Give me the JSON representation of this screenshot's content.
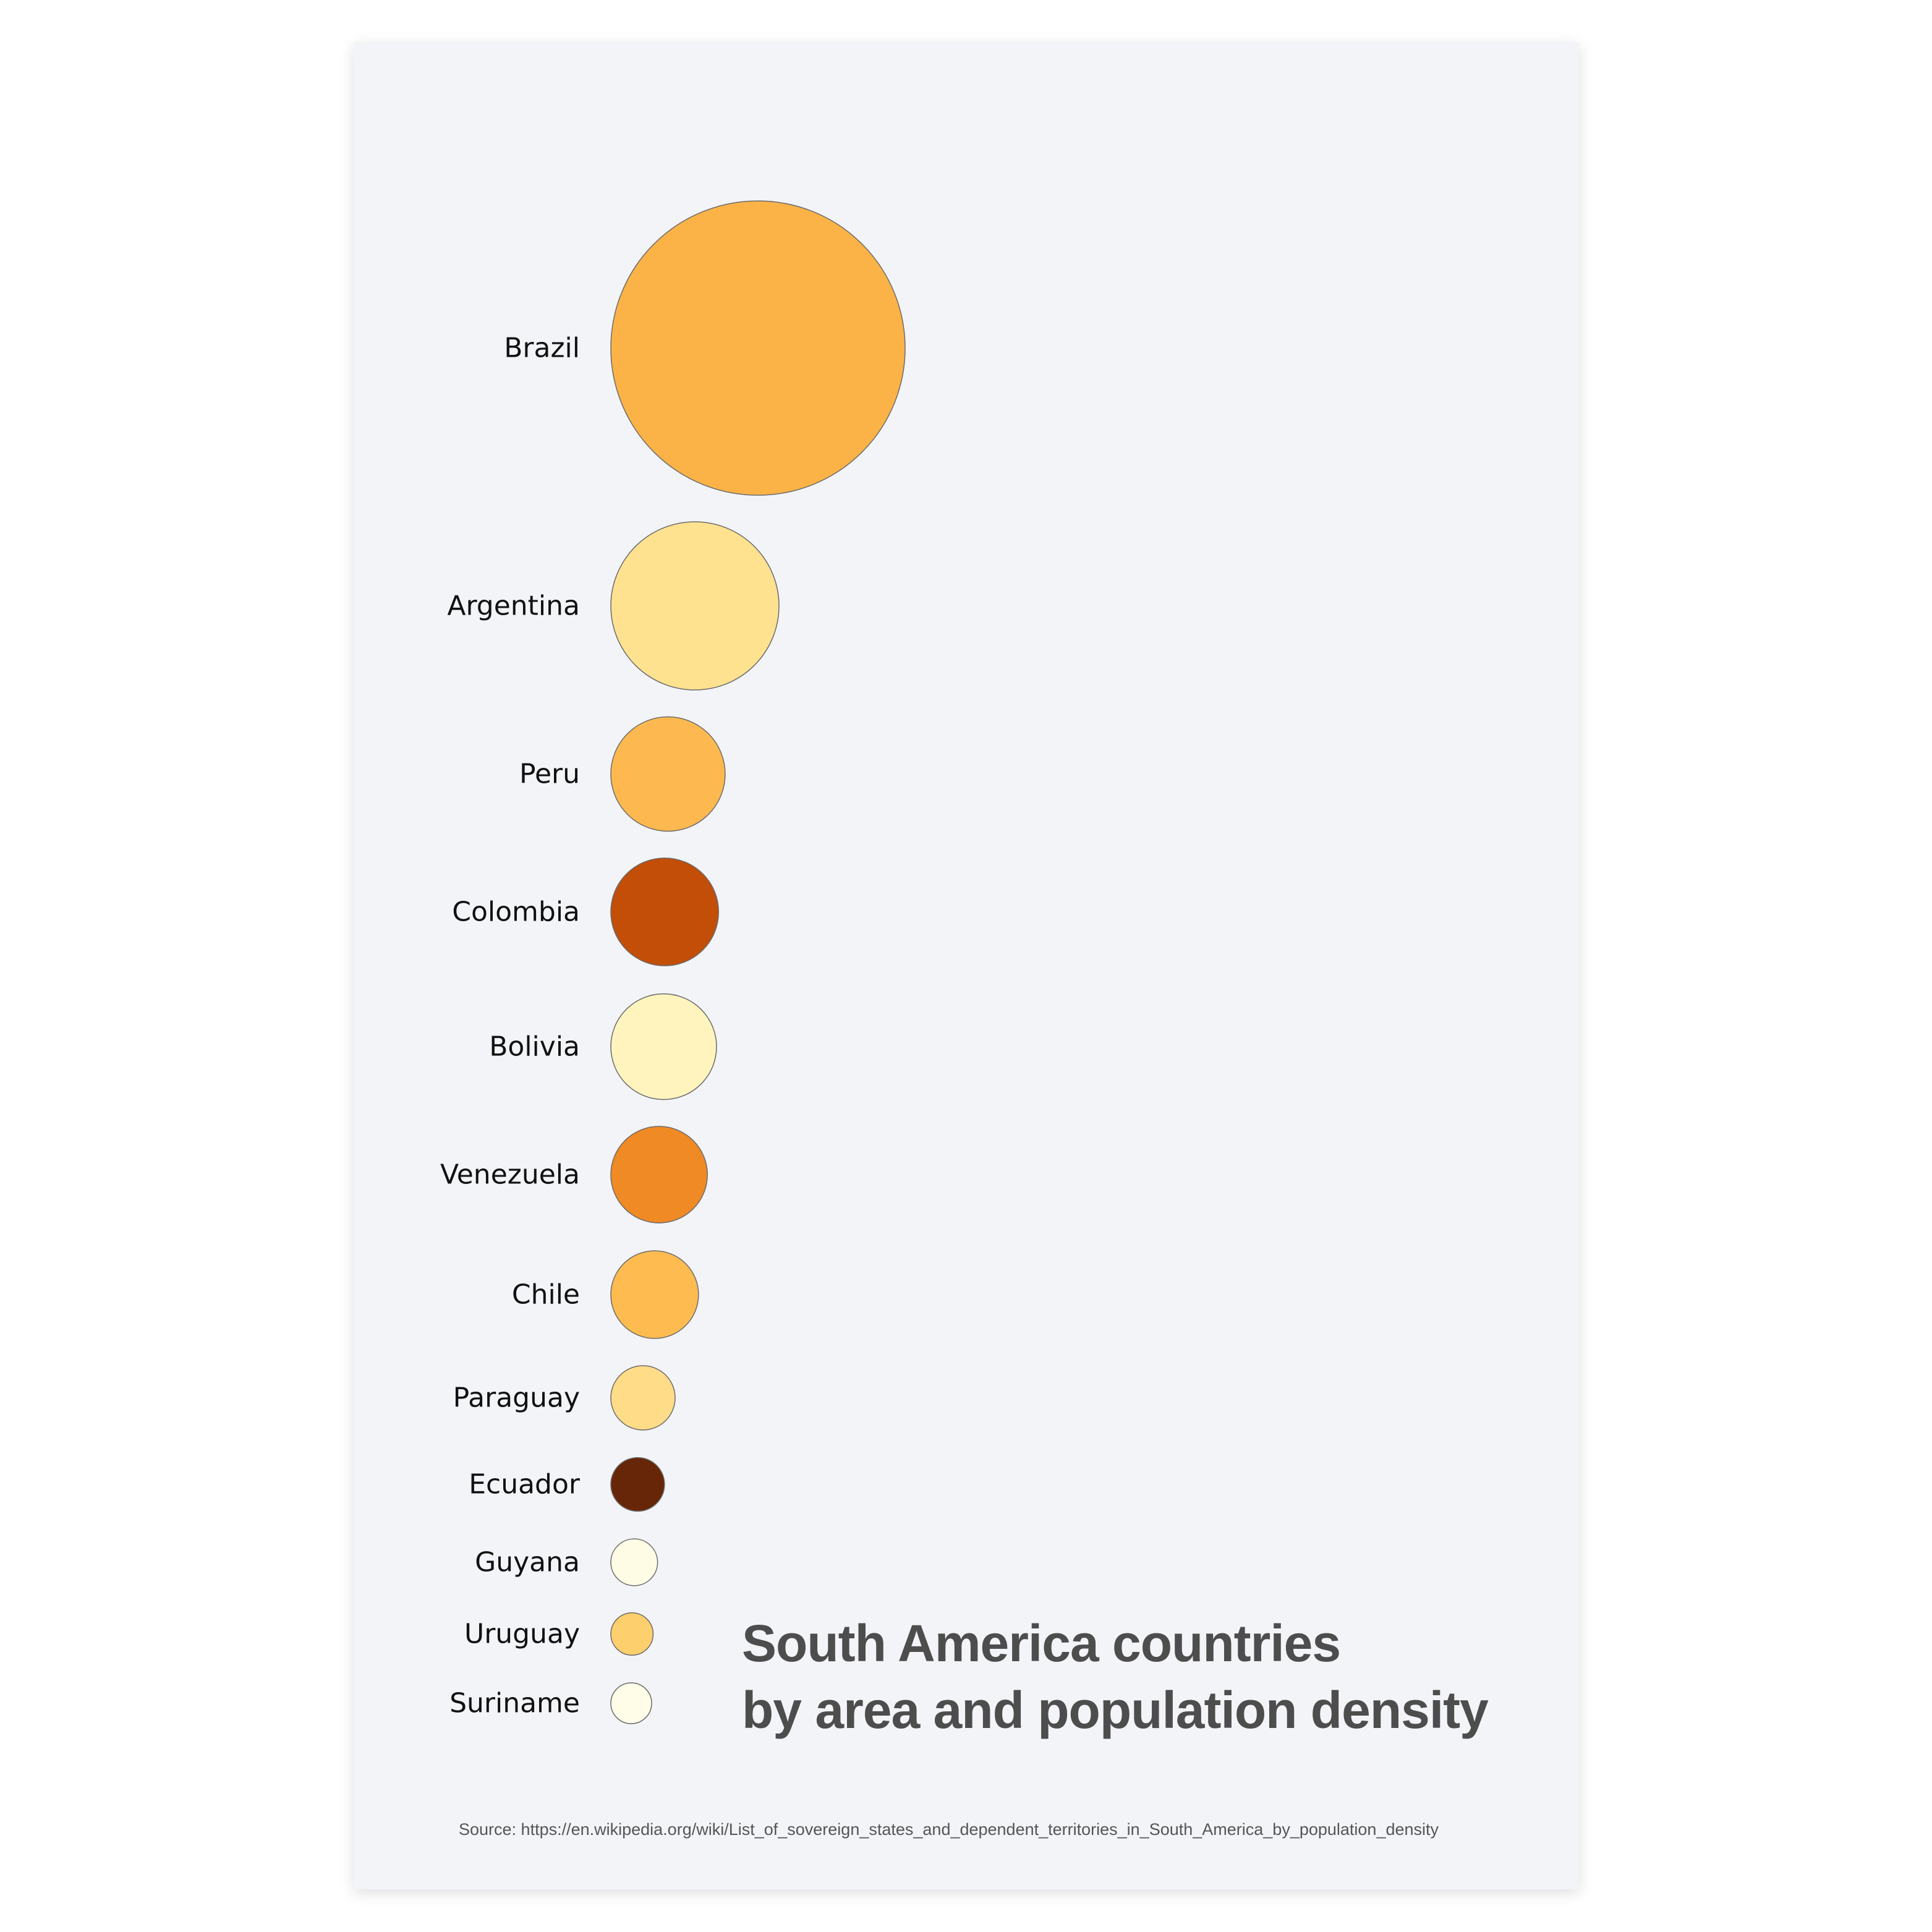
{
  "chart_data": {
    "type": "bubble",
    "title": "South America countries by area and population density",
    "title_lines": [
      "South America countries",
      "by area and population density"
    ],
    "size_encoding": "area (km²)",
    "color_encoding": "population density (darker = denser)",
    "source": "Source: https://en.wikipedia.org/wiki/List_of_sovereign_states_and_dependent_territories_in_South_America_by_population_density",
    "items": [
      {
        "country": "Brazil",
        "area": 8515767,
        "color": "#fbb347"
      },
      {
        "country": "Argentina",
        "area": 2780400,
        "color": "#fee290"
      },
      {
        "country": "Peru",
        "area": 1285216,
        "color": "#fdb94f"
      },
      {
        "country": "Colombia",
        "area": 1141748,
        "color": "#c24e07"
      },
      {
        "country": "Bolivia",
        "area": 1098581,
        "color": "#fff4bd"
      },
      {
        "country": "Venezuela",
        "area": 916445,
        "color": "#f08a24"
      },
      {
        "country": "Chile",
        "area": 756102,
        "color": "#fdbb50"
      },
      {
        "country": "Paraguay",
        "area": 406752,
        "color": "#fedc88"
      },
      {
        "country": "Ecuador",
        "area": 283560,
        "color": "#672607"
      },
      {
        "country": "Guyana",
        "area": 214969,
        "color": "#fffce6"
      },
      {
        "country": "Uruguay",
        "area": 176215,
        "color": "#fecf6d"
      },
      {
        "country": "Suriname",
        "area": 163820,
        "color": "#fffde8"
      }
    ]
  }
}
